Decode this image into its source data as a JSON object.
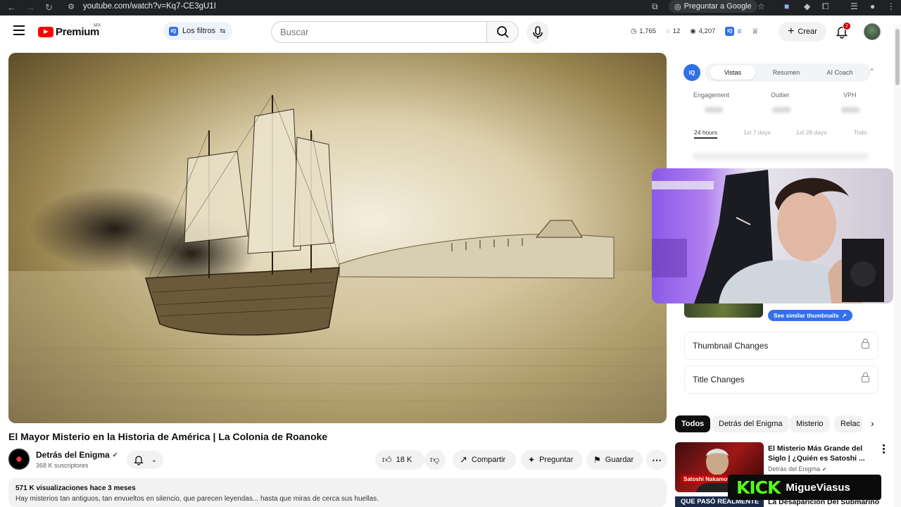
{
  "browser": {
    "url": "youtube.com/watch?v=Kq7-CE3gU1I",
    "ask_google_label": "Preguntar a Google"
  },
  "header": {
    "logo_text": "Premium",
    "region": "MX",
    "filters_label": "Los filtros",
    "search_placeholder": "Buscar",
    "stats": {
      "views": "1,765",
      "comments": "12",
      "subscribers": "4,207"
    },
    "create_label": "Crear",
    "notifications_count": "2"
  },
  "video": {
    "title": "El Mayor Misterio en la Historia de América | La Colonia de Roanoke",
    "channel_name": "Detrás del Enigma",
    "subscribers": "368 K suscriptores",
    "likes": "18 K",
    "share_label": "Compartir",
    "ask_label": "Preguntar",
    "save_label": "Guardar",
    "views_meta": "571 K visualizaciones  hace 3 meses",
    "description": "Hay misterios tan antiguos, tan envueltos en silencio, que parecen leyendas... hasta que miras de cerca sus huellas."
  },
  "iq_panel": {
    "logo": "IQ",
    "tabs": [
      "Vistas",
      "Resumen",
      "AI Coach"
    ],
    "active_tab": "Vistas",
    "metrics": [
      "Engagement",
      "Outlier",
      "VPH"
    ],
    "ranges": [
      "24 hours",
      "1st 7 days",
      "1st 28 days",
      "Todo"
    ],
    "active_range": "24 hours",
    "similar_thumbnails_label": "See similar thumbnails",
    "thumbnail_changes_label": "Thumbnail Changes",
    "title_changes_label": "Title Changes"
  },
  "chips": [
    "Todos",
    "Detrás del Enigma",
    "Misterio",
    "Relac"
  ],
  "recommendations": [
    {
      "title": "El Misterio Más Grande del Siglo | ¿Quién es Satoshi ...",
      "channel": "Detrás del Enigma",
      "thumb_text": "Satoshi Nakamoto"
    },
    {
      "title": "La Desaparición Del Submarino",
      "thumb_text": "QUE PASÓ REALMENTE"
    }
  ],
  "overlay": {
    "kick_logo": "KICK",
    "username": "MigueViasus"
  },
  "colors": {
    "youtube_red": "#ff0000",
    "iq_blue": "#3370e8",
    "kick_green": "#53fc18"
  }
}
